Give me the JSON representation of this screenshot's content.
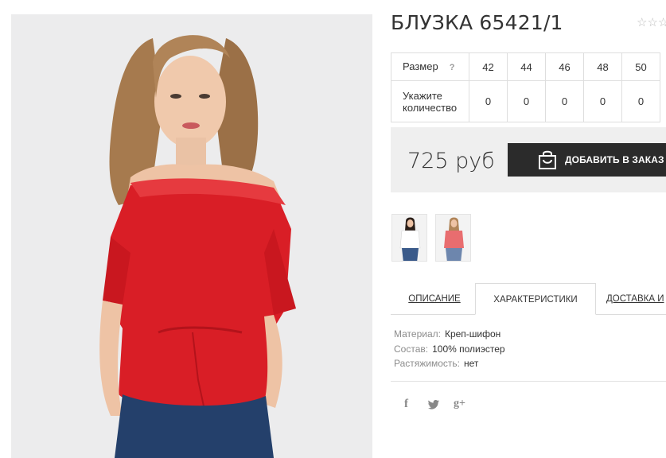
{
  "product": {
    "title": "БЛУЗКА 65421/1",
    "rating_stars": "☆☆☆",
    "rating_value": 0
  },
  "size_table": {
    "size_header": "Размер",
    "help_mark": "?",
    "quantity_header": "Укажите количество",
    "sizes": [
      "42",
      "44",
      "46",
      "48",
      "50"
    ],
    "quantities": [
      "0",
      "0",
      "0",
      "0",
      "0"
    ]
  },
  "purchase": {
    "price": "725 руб",
    "order_label": "ДОБАВИТЬ В ЗАКАЗ",
    "order_icon": "shopping-bag-icon"
  },
  "gallery": {
    "thumbnails": [
      {
        "icon": "model-white-top-thumbnail"
      },
      {
        "icon": "model-red-top-thumbnail"
      }
    ]
  },
  "tabs": [
    {
      "label": "ОПИСАНИЕ",
      "active": false
    },
    {
      "label": "ХАРАКТЕРИСТИКИ",
      "active": true
    },
    {
      "label": "ДОСТАВКА И",
      "active": false
    }
  ],
  "specs": [
    {
      "label": "Материал:",
      "value": "Креп-шифон"
    },
    {
      "label": "Состав:",
      "value": "100% полиэстер"
    },
    {
      "label": "Растяжимость:",
      "value": "нет"
    }
  ],
  "social": {
    "facebook": "f",
    "twitter": "🐦",
    "googleplus": "g+"
  },
  "colors": {
    "blouse": "#d91e26",
    "button_bg": "#2b2b2b",
    "price_bar_bg": "#efefef",
    "photo_bg": "#ececed"
  }
}
